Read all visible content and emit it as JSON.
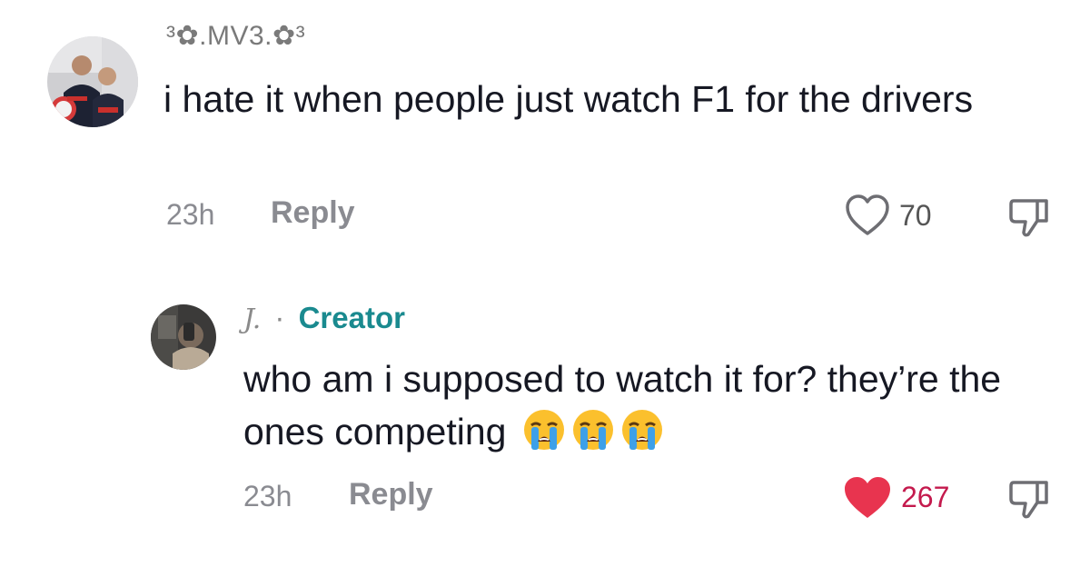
{
  "comments": [
    {
      "username": "³✿.MV3.✿³",
      "text": "i hate it when people just watch F1 for the drivers",
      "time": "23h",
      "reply_label": "Reply",
      "likes": "70",
      "liked": false,
      "avatar_icon": "photo-avatar",
      "like_icon": "heart-outline-icon",
      "dislike_icon": "thumbs-down-icon"
    },
    {
      "username": "J.",
      "separator": "·",
      "badge": "Creator",
      "text": "who am i supposed to watch it for? they’re the ones competing",
      "emojis": [
        "crying-face",
        "crying-face",
        "crying-face"
      ],
      "time": "23h",
      "reply_label": "Reply",
      "likes": "267",
      "liked": true,
      "avatar_icon": "photo-avatar",
      "like_icon": "heart-filled-icon",
      "dislike_icon": "thumbs-down-icon"
    }
  ],
  "colors": {
    "creator": "#1a8a8f",
    "liked": "#e8344f",
    "liked_count": "#c41a4d",
    "muted": "#8a8b91"
  }
}
